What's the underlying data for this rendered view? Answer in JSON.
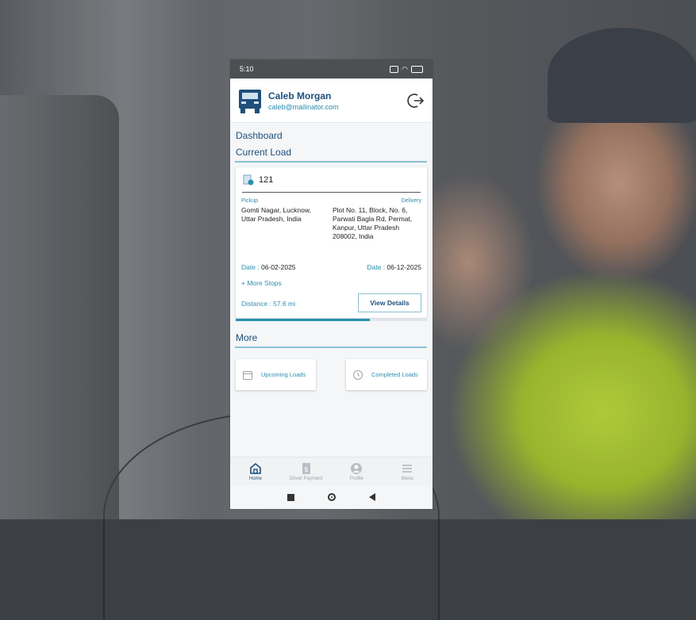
{
  "status_bar": {
    "time": "5:10"
  },
  "header": {
    "user_name": "Caleb  Morgan",
    "user_email": "caleb@mailinator.com"
  },
  "dashboard_title": "Dashboard",
  "current_load": {
    "title": "Current Load",
    "load_number": "121",
    "pickup_label": "Pickup",
    "delivery_label": "Delivery",
    "pickup_address": "Gomti Nagar, Lucknow, Uttar Pradesh, India",
    "delivery_address": "Plot No. 11, Block, No. 6, Parwati Bagla Rd, Permat, Kanpur, Uttar Pradesh 208002, India",
    "pickup_date_label": "Date : ",
    "pickup_date": "06-02-2025",
    "delivery_date_label": "Date : ",
    "delivery_date": "06-12-2025",
    "more_stops": "+ More Stops",
    "distance_label": "Distance : ",
    "distance_value": "57.6 mi",
    "view_details": "View Details",
    "progress_fraction": 0.7
  },
  "more": {
    "title": "More",
    "upcoming": "Upcoming Loads",
    "completed": "Completed Loads"
  },
  "nav": [
    {
      "label": "Home",
      "icon": "home-icon",
      "active": true
    },
    {
      "label": "Driver Payment",
      "icon": "dollar-doc-icon",
      "active": false
    },
    {
      "label": "Profile",
      "icon": "user-icon",
      "active": false
    },
    {
      "label": "Menu",
      "icon": "menu-icon",
      "active": false
    }
  ],
  "colors": {
    "primary": "#1f4f7a",
    "accent": "#2a8fae",
    "divider": "#8cbfd4"
  }
}
